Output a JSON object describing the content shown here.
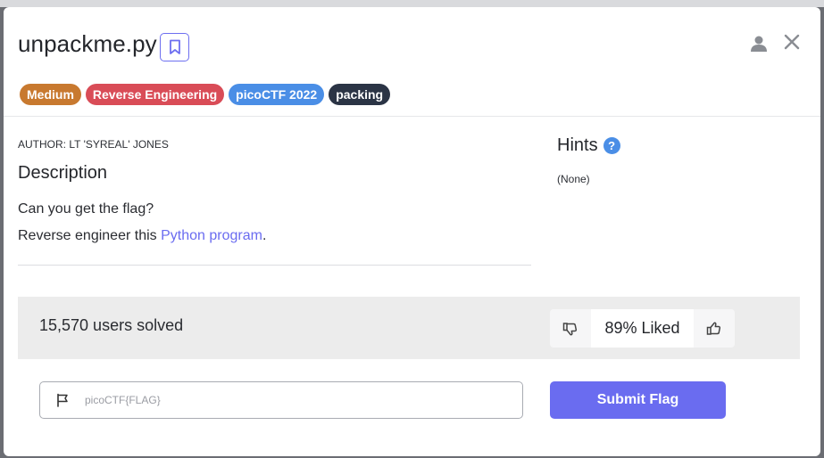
{
  "challenge": {
    "title": "unpackme.py",
    "tags": [
      {
        "label": "Medium",
        "color": "#c8792f"
      },
      {
        "label": "Reverse Engineering",
        "color": "#d94c57"
      },
      {
        "label": "picoCTF 2022",
        "color": "#4a8ee6"
      },
      {
        "label": "packing",
        "color": "#2b3445"
      }
    ],
    "author": "AUTHOR: LT 'SYREAL' JONES",
    "description_heading": "Description",
    "description_line1": "Can you get the flag?",
    "description_line2_prefix": "Reverse engineer this ",
    "description_link": "Python program",
    "description_line2_suffix": "."
  },
  "hints": {
    "heading": "Hints",
    "help_icon": "?",
    "value": "(None)"
  },
  "stats": {
    "solved": "15,570 users solved",
    "liked": "89% Liked"
  },
  "flag_form": {
    "placeholder": "picoCTF{FLAG}",
    "submit_label": "Submit Flag"
  },
  "icons": {
    "bookmark": "bookmark-icon",
    "user": "user-icon",
    "close": "close-icon",
    "dislike": "thumbs-down-icon",
    "like": "thumbs-up-icon",
    "flag": "flag-icon"
  },
  "colors": {
    "accent": "#6a6cf0",
    "help": "#4a8ee6"
  }
}
